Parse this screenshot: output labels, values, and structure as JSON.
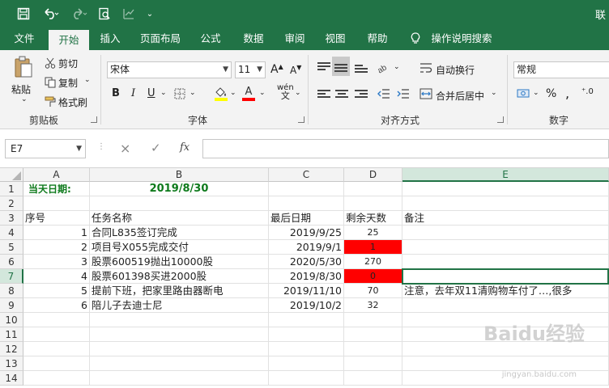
{
  "titlebar": {
    "right_text": "联",
    "save_icon": "save-icon",
    "undo_icon": "undo-icon",
    "redo_icon": "redo-icon"
  },
  "tabs": [
    {
      "label": "文件"
    },
    {
      "label": "开始"
    },
    {
      "label": "插入"
    },
    {
      "label": "页面布局"
    },
    {
      "label": "公式"
    },
    {
      "label": "数据"
    },
    {
      "label": "审阅"
    },
    {
      "label": "视图"
    },
    {
      "label": "帮助"
    },
    {
      "label": "操作说明搜索"
    }
  ],
  "ribbon": {
    "clipboard": {
      "paste": "粘贴",
      "cut": "剪切",
      "copy": "复制",
      "format_painter": "格式刷",
      "group_label": "剪贴板"
    },
    "font": {
      "font_name": "宋体",
      "font_size": "11",
      "bold": "B",
      "italic": "I",
      "underline": "U",
      "grow": "A",
      "shrink": "A",
      "font_color_letter": "A",
      "phonetic": "wén",
      "group_label": "字体"
    },
    "alignment": {
      "wrap_text": "自动换行",
      "merge_center": "合并后居中",
      "group_label": "对齐方式"
    },
    "number": {
      "format": "常规",
      "percent": "%",
      "group_label": "数字"
    }
  },
  "formula_bar": {
    "name_box": "E7",
    "cancel": "×",
    "enter": "✓",
    "fx": "fx",
    "content": ""
  },
  "sheet": {
    "columns": [
      "A",
      "B",
      "C",
      "D",
      "E"
    ],
    "rows": [
      "1",
      "2",
      "3",
      "4",
      "5",
      "6",
      "7",
      "8",
      "9",
      "10",
      "11",
      "12",
      "13",
      "14"
    ],
    "A1": "当天日期:",
    "B1": "2019/8/30",
    "headers": {
      "A3": "序号",
      "B3": "任务名称",
      "C3": "最后日期",
      "D3": "剩余天数",
      "E3": "备注"
    },
    "data": [
      {
        "no": "1",
        "task": "合同L835签订完成",
        "date": "2019/9/25",
        "days": "25",
        "note": "",
        "red": false
      },
      {
        "no": "2",
        "task": "项目号X055完成交付",
        "date": "2019/9/1",
        "days": "1",
        "note": "",
        "red": true
      },
      {
        "no": "3",
        "task": "股票600519抛出10000股",
        "date": "2020/5/30",
        "days": "270",
        "note": "",
        "red": false
      },
      {
        "no": "4",
        "task": "股票601398买进2000股",
        "date": "2019/8/30",
        "days": "0",
        "note": "",
        "red": true
      },
      {
        "no": "5",
        "task": "提前下班，把家里路由器断电",
        "date": "2019/11/10",
        "days": "70",
        "note": "注意，去年双11清购物车付了…,很多",
        "red": false
      },
      {
        "no": "6",
        "task": "陪儿子去迪士尼",
        "date": "2019/10/2",
        "days": "32",
        "note": "",
        "red": false
      }
    ]
  },
  "watermark": {
    "brand": "Baidu经验",
    "site": "jingyan.baidu.com"
  },
  "colors": {
    "excel_green": "#217346",
    "red_fill": "#ff0000",
    "green_text": "#0e7a1c"
  }
}
